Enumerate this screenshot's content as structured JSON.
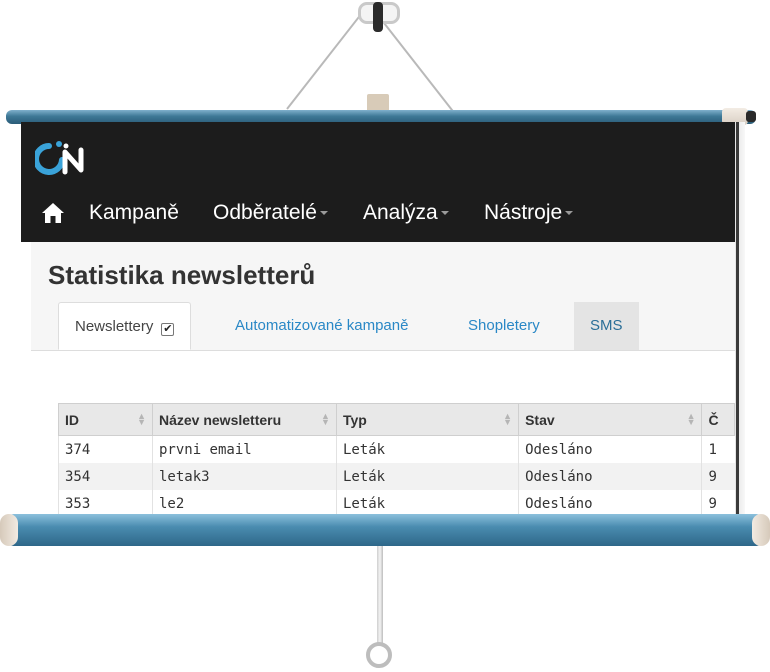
{
  "logo": {
    "icon": "on-logo-icon"
  },
  "nav": {
    "home_icon": "home-icon",
    "items": [
      {
        "label": "Kampaně",
        "has_dropdown": false
      },
      {
        "label": "Odběratelé",
        "has_dropdown": true
      },
      {
        "label": "Analýza",
        "has_dropdown": true
      },
      {
        "label": "Nástroje",
        "has_dropdown": true
      }
    ]
  },
  "page": {
    "title": "Statistika newsletterů"
  },
  "tabs": [
    {
      "label": "Newslettery",
      "active": true,
      "checkbox": "✔"
    },
    {
      "label": "Automatizované kampaně",
      "active": false
    },
    {
      "label": "Shopletery",
      "active": false
    },
    {
      "label": "SMS",
      "active": false
    }
  ],
  "table": {
    "columns": [
      "ID",
      "Název newsletteru",
      "Typ",
      "Stav",
      "Č"
    ],
    "rows": [
      [
        "374",
        "prvni email",
        "Leták",
        "Odesláno",
        "1"
      ],
      [
        "354",
        "letak3",
        "Leták",
        "Odesláno",
        "9"
      ],
      [
        "353",
        "le2",
        "Leták",
        "Odesláno",
        "9"
      ]
    ]
  },
  "colors": {
    "topbar": "#1c1c1c",
    "link": "#2a88c6",
    "roller": "#3e7896",
    "logo_accent": "#3aa3d9"
  }
}
